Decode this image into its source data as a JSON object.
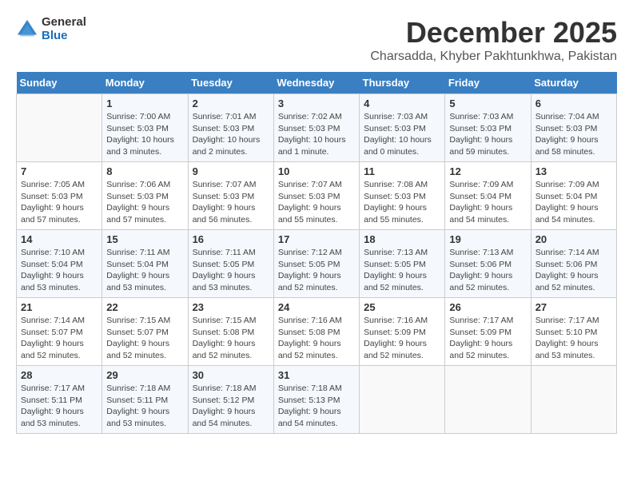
{
  "logo": {
    "general": "General",
    "blue": "Blue"
  },
  "header": {
    "month": "December 2025",
    "location": "Charsadda, Khyber Pakhtunkhwa, Pakistan"
  },
  "weekdays": [
    "Sunday",
    "Monday",
    "Tuesday",
    "Wednesday",
    "Thursday",
    "Friday",
    "Saturday"
  ],
  "weeks": [
    [
      {
        "day": "",
        "info": ""
      },
      {
        "day": "1",
        "info": "Sunrise: 7:00 AM\nSunset: 5:03 PM\nDaylight: 10 hours\nand 3 minutes."
      },
      {
        "day": "2",
        "info": "Sunrise: 7:01 AM\nSunset: 5:03 PM\nDaylight: 10 hours\nand 2 minutes."
      },
      {
        "day": "3",
        "info": "Sunrise: 7:02 AM\nSunset: 5:03 PM\nDaylight: 10 hours\nand 1 minute."
      },
      {
        "day": "4",
        "info": "Sunrise: 7:03 AM\nSunset: 5:03 PM\nDaylight: 10 hours\nand 0 minutes."
      },
      {
        "day": "5",
        "info": "Sunrise: 7:03 AM\nSunset: 5:03 PM\nDaylight: 9 hours\nand 59 minutes."
      },
      {
        "day": "6",
        "info": "Sunrise: 7:04 AM\nSunset: 5:03 PM\nDaylight: 9 hours\nand 58 minutes."
      }
    ],
    [
      {
        "day": "7",
        "info": "Sunrise: 7:05 AM\nSunset: 5:03 PM\nDaylight: 9 hours\nand 57 minutes."
      },
      {
        "day": "8",
        "info": "Sunrise: 7:06 AM\nSunset: 5:03 PM\nDaylight: 9 hours\nand 57 minutes."
      },
      {
        "day": "9",
        "info": "Sunrise: 7:07 AM\nSunset: 5:03 PM\nDaylight: 9 hours\nand 56 minutes."
      },
      {
        "day": "10",
        "info": "Sunrise: 7:07 AM\nSunset: 5:03 PM\nDaylight: 9 hours\nand 55 minutes."
      },
      {
        "day": "11",
        "info": "Sunrise: 7:08 AM\nSunset: 5:03 PM\nDaylight: 9 hours\nand 55 minutes."
      },
      {
        "day": "12",
        "info": "Sunrise: 7:09 AM\nSunset: 5:04 PM\nDaylight: 9 hours\nand 54 minutes."
      },
      {
        "day": "13",
        "info": "Sunrise: 7:09 AM\nSunset: 5:04 PM\nDaylight: 9 hours\nand 54 minutes."
      }
    ],
    [
      {
        "day": "14",
        "info": "Sunrise: 7:10 AM\nSunset: 5:04 PM\nDaylight: 9 hours\nand 53 minutes."
      },
      {
        "day": "15",
        "info": "Sunrise: 7:11 AM\nSunset: 5:04 PM\nDaylight: 9 hours\nand 53 minutes."
      },
      {
        "day": "16",
        "info": "Sunrise: 7:11 AM\nSunset: 5:05 PM\nDaylight: 9 hours\nand 53 minutes."
      },
      {
        "day": "17",
        "info": "Sunrise: 7:12 AM\nSunset: 5:05 PM\nDaylight: 9 hours\nand 52 minutes."
      },
      {
        "day": "18",
        "info": "Sunrise: 7:13 AM\nSunset: 5:05 PM\nDaylight: 9 hours\nand 52 minutes."
      },
      {
        "day": "19",
        "info": "Sunrise: 7:13 AM\nSunset: 5:06 PM\nDaylight: 9 hours\nand 52 minutes."
      },
      {
        "day": "20",
        "info": "Sunrise: 7:14 AM\nSunset: 5:06 PM\nDaylight: 9 hours\nand 52 minutes."
      }
    ],
    [
      {
        "day": "21",
        "info": "Sunrise: 7:14 AM\nSunset: 5:07 PM\nDaylight: 9 hours\nand 52 minutes."
      },
      {
        "day": "22",
        "info": "Sunrise: 7:15 AM\nSunset: 5:07 PM\nDaylight: 9 hours\nand 52 minutes."
      },
      {
        "day": "23",
        "info": "Sunrise: 7:15 AM\nSunset: 5:08 PM\nDaylight: 9 hours\nand 52 minutes."
      },
      {
        "day": "24",
        "info": "Sunrise: 7:16 AM\nSunset: 5:08 PM\nDaylight: 9 hours\nand 52 minutes."
      },
      {
        "day": "25",
        "info": "Sunrise: 7:16 AM\nSunset: 5:09 PM\nDaylight: 9 hours\nand 52 minutes."
      },
      {
        "day": "26",
        "info": "Sunrise: 7:17 AM\nSunset: 5:09 PM\nDaylight: 9 hours\nand 52 minutes."
      },
      {
        "day": "27",
        "info": "Sunrise: 7:17 AM\nSunset: 5:10 PM\nDaylight: 9 hours\nand 53 minutes."
      }
    ],
    [
      {
        "day": "28",
        "info": "Sunrise: 7:17 AM\nSunset: 5:11 PM\nDaylight: 9 hours\nand 53 minutes."
      },
      {
        "day": "29",
        "info": "Sunrise: 7:18 AM\nSunset: 5:11 PM\nDaylight: 9 hours\nand 53 minutes."
      },
      {
        "day": "30",
        "info": "Sunrise: 7:18 AM\nSunset: 5:12 PM\nDaylight: 9 hours\nand 54 minutes."
      },
      {
        "day": "31",
        "info": "Sunrise: 7:18 AM\nSunset: 5:13 PM\nDaylight: 9 hours\nand 54 minutes."
      },
      {
        "day": "",
        "info": ""
      },
      {
        "day": "",
        "info": ""
      },
      {
        "day": "",
        "info": ""
      }
    ]
  ]
}
